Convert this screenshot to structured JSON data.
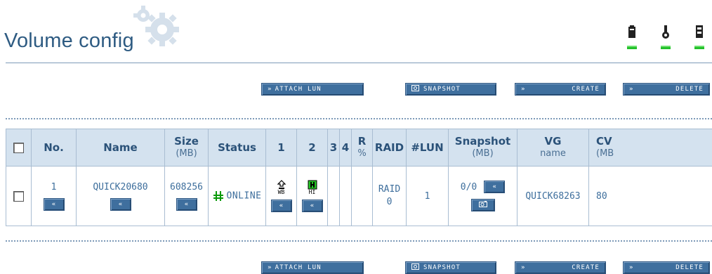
{
  "page": {
    "title": "Volume config"
  },
  "header_icons": [
    {
      "icon": "battery-icon",
      "status": "ok",
      "color": "#22c02a"
    },
    {
      "icon": "thermometer-icon",
      "status": "ok",
      "color": "#22c02a"
    },
    {
      "icon": "disk-icon",
      "status": "ok",
      "color": "#22c02a"
    }
  ],
  "toolbar": {
    "attach_lun": {
      "prefix": "»",
      "label": "ATTACH LUN"
    },
    "snapshot": {
      "label": "SNAPSHOT"
    },
    "create": {
      "prefix": "»",
      "label": "CREATE"
    },
    "delete": {
      "prefix": "»",
      "label": "DELETE"
    }
  },
  "table": {
    "headers": {
      "no": "No.",
      "name": "Name",
      "size": "Size",
      "size_unit": "(MB)",
      "status": "Status",
      "d1": "1",
      "d2": "2",
      "d3": "3",
      "d4": "4",
      "r": "R",
      "r_unit": "%",
      "raid": "RAID",
      "lun": "#LUN",
      "snapshot": "Snapshot",
      "snapshot_unit": "(MB)",
      "vg": "VG",
      "vg_unit": "name",
      "cv": "CV",
      "cv_unit": "(MB"
    },
    "rows": [
      {
        "no": "1",
        "name": "QUICK20680",
        "size": "608256",
        "status": "ONLINE",
        "disk1_label": "WB",
        "disk2_label": "HI",
        "raid_line1": "RAID",
        "raid_line2": "0",
        "lun": "1",
        "snapshot": "0/0",
        "vg_name": "QUICK68263",
        "cv": "80"
      }
    ],
    "expand_glyph": "«"
  },
  "colors": {
    "accent": "#3f6f9e",
    "header_bg": "#d4e2ef",
    "border": "#a9bdd2",
    "title": "#2e5b82",
    "status_led": "#22c02a"
  }
}
